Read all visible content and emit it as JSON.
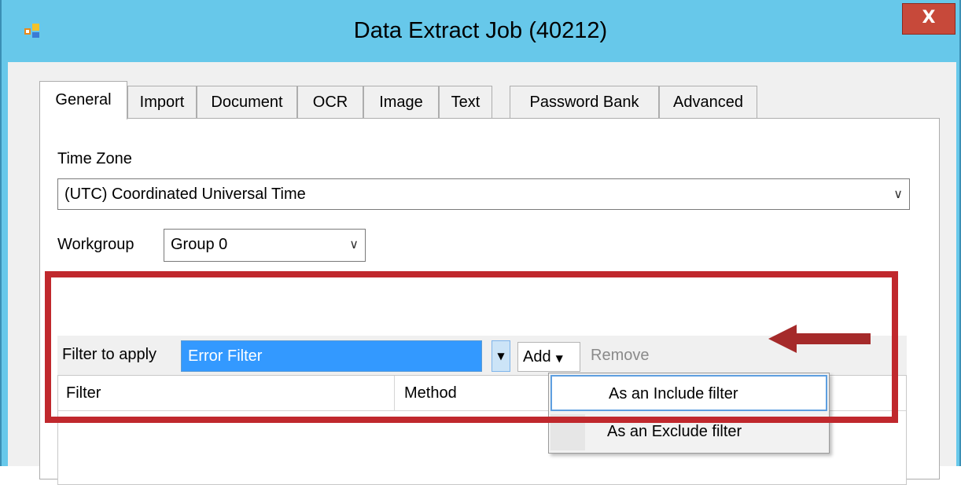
{
  "window": {
    "title": "Data Extract Job (40212)",
    "close_label": "X"
  },
  "tabs": [
    {
      "label": "General",
      "active": true
    },
    {
      "label": "Import"
    },
    {
      "label": "Document"
    },
    {
      "label": "OCR"
    },
    {
      "label": "Image"
    },
    {
      "label": "Text"
    },
    {
      "label": "Password Bank"
    },
    {
      "label": "Advanced"
    }
  ],
  "general": {
    "time_zone_label": "Time Zone",
    "time_zone_value": "(UTC) Coordinated Universal Time",
    "workgroup_label": "Workgroup",
    "workgroup_value": "Group 0"
  },
  "filter": {
    "label": "Filter to apply",
    "selected": "Error Filter",
    "add_label": "Add",
    "remove_label": "Remove",
    "columns": [
      "Filter",
      "Method"
    ]
  },
  "add_menu": {
    "items": [
      "As an Include filter",
      "As an Exclude filter"
    ]
  },
  "colors": {
    "titlebar": "#67c8ea",
    "highlight_box": "#c0282d",
    "selection": "#3399ff"
  }
}
